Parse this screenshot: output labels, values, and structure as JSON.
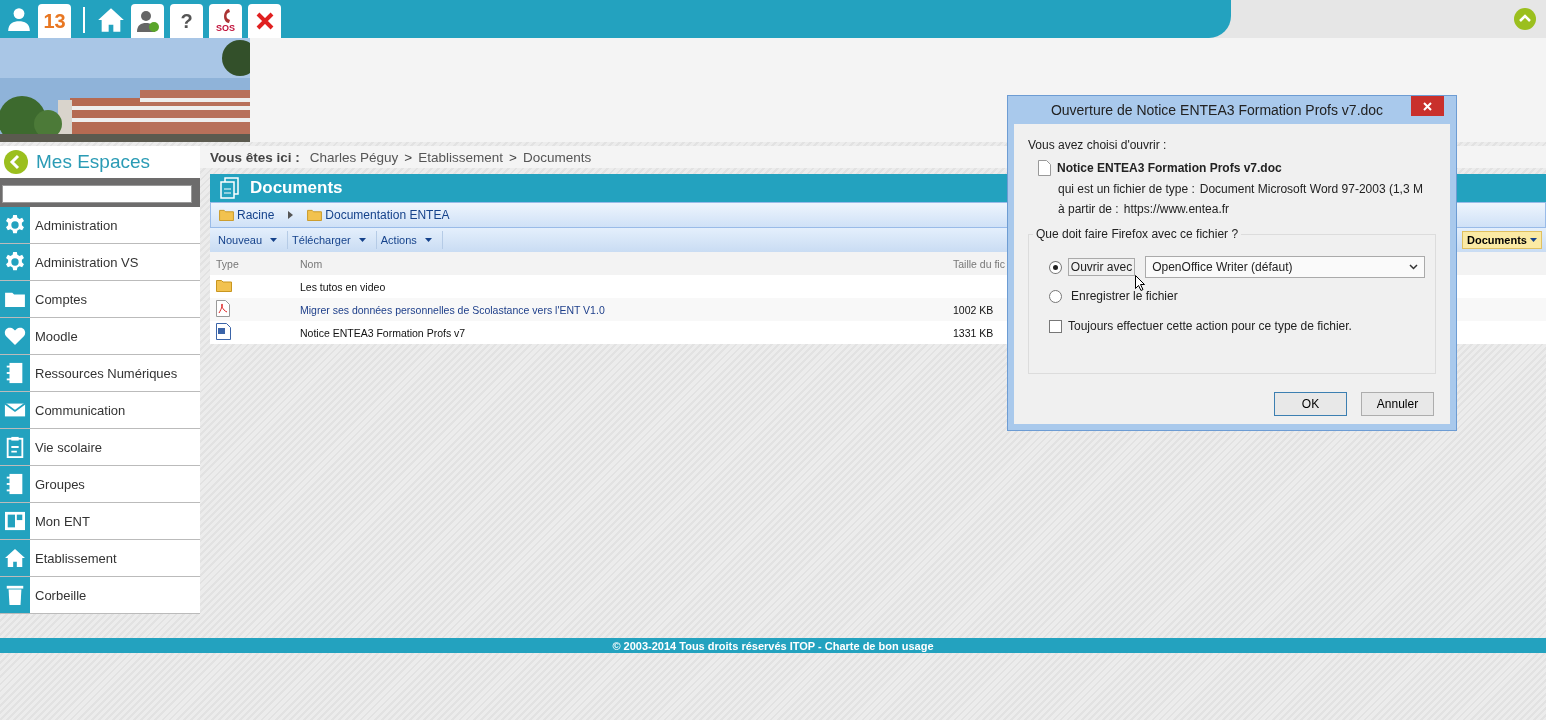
{
  "top_bar": {
    "notifications": "13",
    "help": "?",
    "sos": "SOS"
  },
  "sidebar": {
    "title": "Mes Espaces",
    "items": [
      {
        "label": "Administration",
        "kind": "gear"
      },
      {
        "label": "Administration VS",
        "kind": "gear"
      },
      {
        "label": "Comptes",
        "kind": "folder"
      },
      {
        "label": "Moodle",
        "kind": "heart"
      },
      {
        "label": "Ressources Numériques",
        "kind": "book"
      },
      {
        "label": "Communication",
        "kind": "mail"
      },
      {
        "label": "Vie scolaire",
        "kind": "clipboard"
      },
      {
        "label": "Groupes",
        "kind": "book"
      },
      {
        "label": "Mon ENT",
        "kind": "layout"
      },
      {
        "label": "Etablissement",
        "kind": "home"
      },
      {
        "label": "Corbeille",
        "kind": "trash"
      }
    ]
  },
  "breadcrumb": {
    "label": "Vous êtes ici :",
    "separator": ">",
    "items": [
      "Charles Péguy",
      "Etablissement",
      "Documents"
    ]
  },
  "documents": {
    "title": "Documents",
    "path": [
      "Racine",
      "Documentation ENTEA"
    ],
    "toolbar": [
      "Nouveau",
      "Télécharger",
      "Actions"
    ],
    "view_button": "Documents",
    "columns": [
      "Type",
      "Nom",
      "Taille du fic"
    ],
    "rows": [
      {
        "kind": "folder",
        "name": "Les tutos en video",
        "size": "",
        "link": false
      },
      {
        "kind": "pdf",
        "name": "Migrer ses données personnelles de Scolastance vers l'ENT V1.0",
        "size": "1002 KB",
        "link": true
      },
      {
        "kind": "word",
        "name": "Notice ENTEA3 Formation Profs v7",
        "size": "1331 KB",
        "link": false
      }
    ]
  },
  "footer": "© 2003-2014 Tous droits réservés ITOP  - Charte de bon usage",
  "dialog": {
    "title": "Ouverture de Notice ENTEA3 Formation Profs v7.doc",
    "intro": "Vous avez choisi d'ouvrir :",
    "filename": "Notice ENTEA3 Formation Profs v7.doc",
    "type_label": "qui est un fichier de type :",
    "type_value": "Document Microsoft Word 97-2003 (1,3 M",
    "source_label": "à partir de :",
    "source_value": "https://www.entea.fr",
    "question": "Que doit faire Firefox avec ce fichier ?",
    "options": [
      {
        "label": "Ouvrir avec",
        "selected": true
      },
      {
        "label": "Enregistrer le fichier",
        "selected": false
      }
    ],
    "application": "OpenOffice Writer (défaut)",
    "remember": {
      "label": "Toujours effectuer cette action pour ce type de fichier.",
      "checked": false
    },
    "buttons": [
      "OK",
      "Annuler"
    ]
  }
}
